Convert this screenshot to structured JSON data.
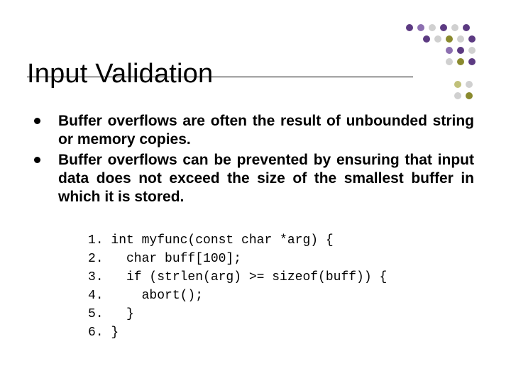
{
  "title": "Input Validation",
  "bullets": [
    "Buffer overflows are often the result of unbounded string or memory copies.",
    "Buffer overflows can be prevented by ensuring that input data does not exceed the size of the smallest buffer in which it is stored."
  ],
  "code_lines": [
    "1. int myfunc(const char *arg) {",
    "2.   char buff[100];",
    "3.   if (strlen(arg) >= sizeof(buff)) {",
    "4.     abort();",
    "5.   }",
    "6. }"
  ],
  "dot_colors": {
    "purple_dark": "#5c3a82",
    "purple_mid": "#8c6fb0",
    "olive": "#8a8a2e",
    "olive_light": "#c0c07a",
    "grey": "#d0d0d0"
  }
}
